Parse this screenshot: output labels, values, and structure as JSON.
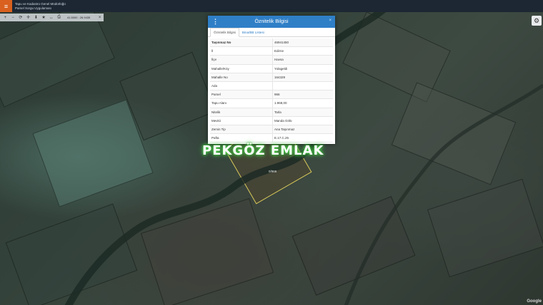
{
  "header": {
    "menu_icon": "menu-icon",
    "org_name": "Tapu ve Kadastro Genel Müdürlüğü",
    "app_name": "Parsel Sorgu Uygulaması"
  },
  "toolbar": {
    "icons": [
      "zoom-in-icon",
      "zoom-out-icon",
      "refresh-icon",
      "locate-icon",
      "pin-icon",
      "star-icon",
      "measure-icon",
      "print-icon",
      "close-icon"
    ],
    "coordinate": "41.5000 : 26.9435"
  },
  "dialog": {
    "title": "Öznitelik Bilgisi",
    "close_symbol": "×",
    "tabs": [
      {
        "label": "Öznitelik Bilgisi",
        "active": true
      },
      {
        "label": "Bina/BB Listesi",
        "active": false
      }
    ],
    "rows": [
      {
        "key": "Taşınmaz No",
        "value": "46941450"
      },
      {
        "key": "İl",
        "value": "Edirne"
      },
      {
        "key": "İlçe",
        "value": "Havsa"
      },
      {
        "key": "Mahalle/Köy",
        "value": "Yolageldi"
      },
      {
        "key": "Mahalle No",
        "value": "164329"
      },
      {
        "key": "Ada",
        "value": ""
      },
      {
        "key": "Parsel",
        "value": "966"
      },
      {
        "key": "Tapu Alanı",
        "value": "1.968,00"
      },
      {
        "key": "Nitelik",
        "value": "Tarla"
      },
      {
        "key": "Mevkii",
        "value": "Manda Gölü"
      },
      {
        "key": "Zemin Tip",
        "value": "Ana Taşınmaz"
      },
      {
        "key": "Pafta",
        "value": "E.17.C.25"
      }
    ]
  },
  "watermark": "PEKGÖZ EMLAK",
  "map": {
    "parcel_label": "0/966",
    "attribution": "Google"
  },
  "colors": {
    "header_bg": "#1d2733",
    "menu_button": "#d9601e",
    "dialog_header": "#2f7fc7"
  }
}
